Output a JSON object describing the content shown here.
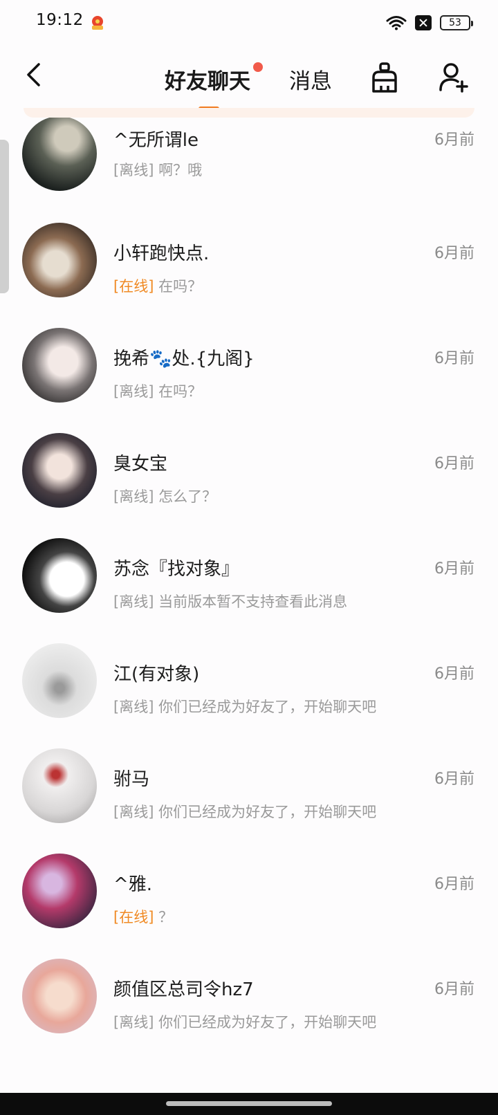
{
  "status_bar": {
    "time": "19:12",
    "battery": "53"
  },
  "nav": {
    "tab_friends": "好友聊天",
    "tab_messages": "消息",
    "accent_color": "#f07a1e",
    "badge_color": "#f15a4a"
  },
  "chats": [
    {
      "name": "^无所谓le",
      "time": "6月前",
      "status": "[离线]",
      "online": false,
      "preview": "啊？哦"
    },
    {
      "name": "小轩跑快点.",
      "time": "6月前",
      "status": "[在线]",
      "online": true,
      "preview": "在吗？"
    },
    {
      "name": "挽希🐾处.{九阁}",
      "time": "6月前",
      "status": "[离线]",
      "online": false,
      "preview": "在吗？"
    },
    {
      "name": "臭女宝",
      "time": "6月前",
      "status": "[离线]",
      "online": false,
      "preview": "怎么了？"
    },
    {
      "name": "苏念『找对象』",
      "time": "6月前",
      "status": "[离线]",
      "online": false,
      "preview": "当前版本暂不支持查看此消息"
    },
    {
      "name": "江(有对象)",
      "time": "6月前",
      "status": "[离线]",
      "online": false,
      "preview": "你们已经成为好友了，开始聊天吧"
    },
    {
      "name": "驸马",
      "time": "6月前",
      "status": "[离线]",
      "online": false,
      "preview": "你们已经成为好友了，开始聊天吧"
    },
    {
      "name": "^雅.",
      "time": "6月前",
      "status": "[在线]",
      "online": true,
      "preview": "？"
    },
    {
      "name": "颜值区总司令hz7",
      "time": "6月前",
      "status": "[离线]",
      "online": false,
      "preview": "你们已经成为好友了，开始聊天吧"
    }
  ]
}
